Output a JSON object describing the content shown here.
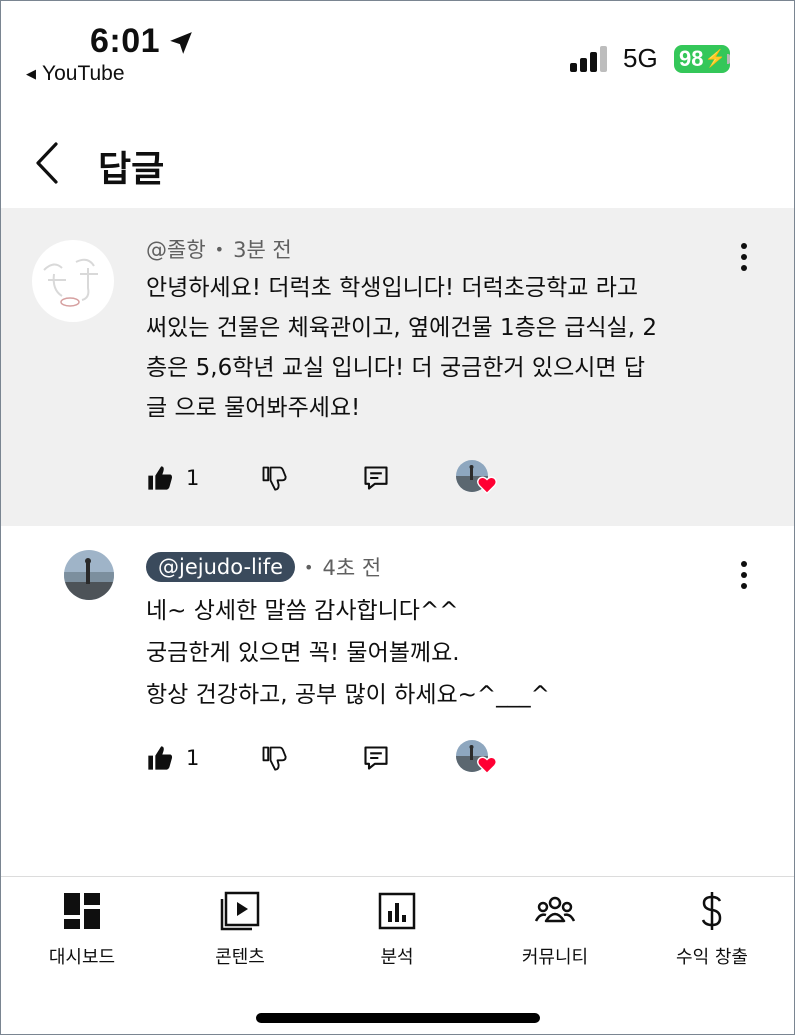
{
  "status_bar": {
    "time": "6:01",
    "back_app": "YouTube",
    "network": "5G",
    "battery": "98"
  },
  "header": {
    "title": "답글"
  },
  "comments": [
    {
      "author": "@졸항",
      "time": "3분 전",
      "lines": [
        "안녕하세요! 더럭초 학생입니다! 더럭초긍학교 라고",
        "써있는 건물은 체육관이고, 옆에건물 1층은 급식실, 2",
        "층은 5,6학년 교실 입니다! 더 궁금한거 있으시면 답",
        "글 으로 물어봐주세요!"
      ],
      "likes": "1"
    },
    {
      "author": "@jejudo-life",
      "time": "4초 전",
      "lines": [
        "네~ 상세한 말씀 감사합니다^^",
        "궁금한게 있으면 꼭! 물어볼께요.",
        "항상 건강하고, 공부 많이 하세요~^___^"
      ],
      "likes": "1"
    }
  ],
  "bottom_nav": [
    {
      "label": "대시보드",
      "icon": "dashboard-icon"
    },
    {
      "label": "콘텐츠",
      "icon": "content-icon"
    },
    {
      "label": "분석",
      "icon": "analytics-icon"
    },
    {
      "label": "커뮤니티",
      "icon": "community-icon"
    },
    {
      "label": "수익 창출",
      "icon": "monetization-icon"
    }
  ],
  "colors": {
    "highlight_bg": "#f0f0f0",
    "handle_pill": "#3a4a5c",
    "battery": "#34c759",
    "heart": "#ff0033"
  }
}
